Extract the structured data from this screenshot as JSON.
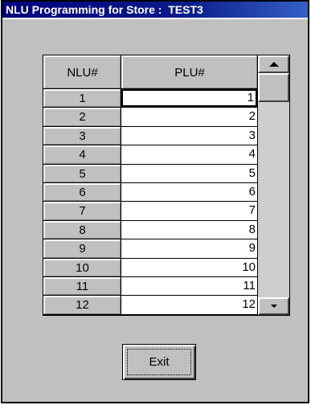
{
  "window": {
    "title": "NLU Programming for Store :  TEST3"
  },
  "grid": {
    "columns": {
      "nlu": "NLU#",
      "plu": "PLU#"
    },
    "rows": [
      {
        "nlu": "1",
        "plu": "1"
      },
      {
        "nlu": "2",
        "plu": "2"
      },
      {
        "nlu": "3",
        "plu": "3"
      },
      {
        "nlu": "4",
        "plu": "4"
      },
      {
        "nlu": "5",
        "plu": "5"
      },
      {
        "nlu": "6",
        "plu": "6"
      },
      {
        "nlu": "7",
        "plu": "7"
      },
      {
        "nlu": "8",
        "plu": "8"
      },
      {
        "nlu": "9",
        "plu": "9"
      },
      {
        "nlu": "10",
        "plu": "10"
      },
      {
        "nlu": "11",
        "plu": "11"
      },
      {
        "nlu": "12",
        "plu": "12"
      }
    ],
    "active_row_index": 0
  },
  "buttons": {
    "exit": "Exit"
  },
  "icons": {
    "scroll_up": "scroll-up-arrow-icon",
    "scroll_down": "scroll-down-arrow-icon"
  },
  "colors": {
    "titlebar": "#00007b",
    "face": "#c0c0c0",
    "cell": "#ffffff"
  }
}
